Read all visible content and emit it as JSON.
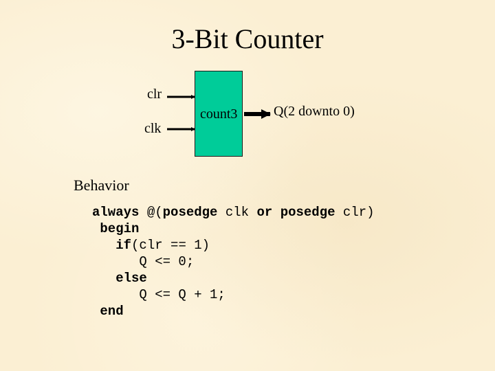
{
  "slide": {
    "title": "3-Bit Counter",
    "diagram": {
      "inputs": [
        {
          "name": "clr"
        },
        {
          "name": "clk"
        }
      ],
      "block": {
        "label": "count3",
        "color": "#00cc99"
      },
      "output": {
        "label": "Q(2 downto 0)"
      }
    },
    "behavior_heading": "Behavior",
    "code_lines": [
      [
        {
          "t": "always",
          "b": true
        },
        {
          "t": " @(",
          "b": false
        },
        {
          "t": "posedge",
          "b": true
        },
        {
          "t": " clk ",
          "b": false
        },
        {
          "t": "or",
          "b": true
        },
        {
          "t": " ",
          "b": false
        },
        {
          "t": "posedge",
          "b": true
        },
        {
          "t": " clr)",
          "b": false
        }
      ],
      [
        {
          "t": " ",
          "b": false
        },
        {
          "t": "begin",
          "b": true
        }
      ],
      [
        {
          "t": "   ",
          "b": false
        },
        {
          "t": "if",
          "b": true
        },
        {
          "t": "(clr == 1)",
          "b": false
        }
      ],
      [
        {
          "t": "      Q <= 0;",
          "b": false
        }
      ],
      [
        {
          "t": "   ",
          "b": false
        },
        {
          "t": "else",
          "b": true
        }
      ],
      [
        {
          "t": "      Q <= Q + 1;",
          "b": false
        }
      ],
      [
        {
          "t": " ",
          "b": false
        },
        {
          "t": "end",
          "b": true
        }
      ]
    ]
  }
}
